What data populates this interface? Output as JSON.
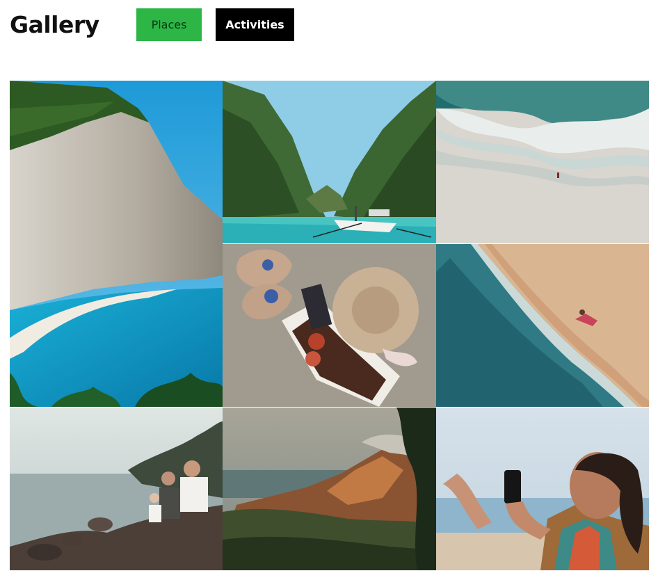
{
  "header": {
    "title": "Gallery",
    "tabs": [
      {
        "label": "Places",
        "active": false,
        "color": "#2db646"
      },
      {
        "label": "Activities",
        "active": true,
        "color": "#000000"
      }
    ]
  },
  "gallery": {
    "photos": [
      {
        "subject": "white cliff above turquoise bay"
      },
      {
        "subject": "boats between green limestone cliffs"
      },
      {
        "subject": "aerial view of waves on sandy beach"
      },
      {
        "subject": "straw hat, slippers, book and apples on sand"
      },
      {
        "subject": "aerial view of person lying at shoreline"
      },
      {
        "subject": "family sitting on rocks by the sea"
      },
      {
        "subject": "mountain ridge at sunset"
      },
      {
        "subject": "woman taking a selfie in a beach chair"
      }
    ]
  }
}
